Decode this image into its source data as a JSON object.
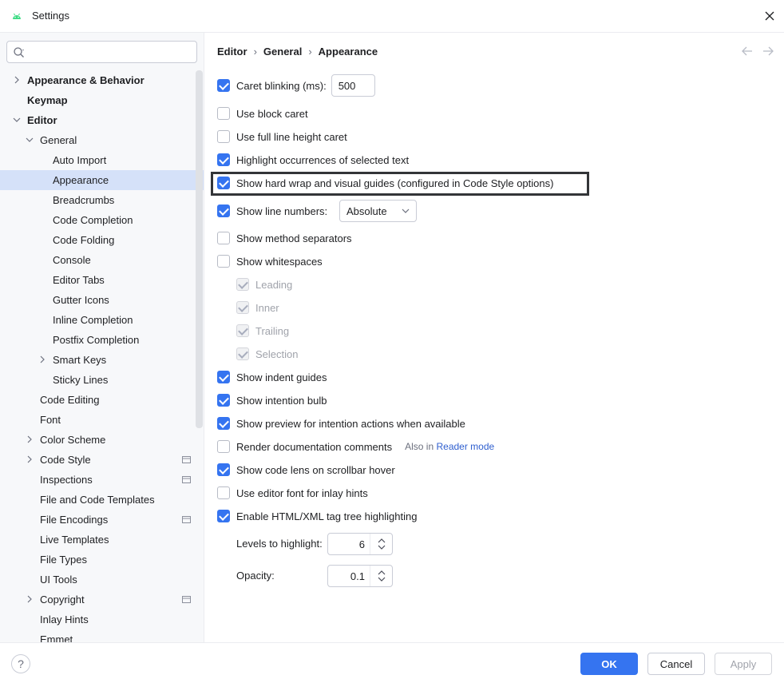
{
  "window": {
    "title": "Settings"
  },
  "search": {
    "value": "",
    "placeholder": ""
  },
  "sidebar": {
    "items": [
      {
        "label": "Appearance & Behavior",
        "bold": true,
        "chevron": "right"
      },
      {
        "label": "Keymap",
        "bold": true,
        "chevron": ""
      },
      {
        "label": "Editor",
        "bold": true,
        "chevron": "down"
      },
      {
        "label": "General",
        "bold": false,
        "chevron": "down"
      },
      {
        "label": "Auto Import",
        "bold": false,
        "chevron": ""
      },
      {
        "label": "Appearance",
        "bold": false,
        "chevron": "",
        "selected": true
      },
      {
        "label": "Breadcrumbs",
        "bold": false,
        "chevron": ""
      },
      {
        "label": "Code Completion",
        "bold": false,
        "chevron": ""
      },
      {
        "label": "Code Folding",
        "bold": false,
        "chevron": ""
      },
      {
        "label": "Console",
        "bold": false,
        "chevron": ""
      },
      {
        "label": "Editor Tabs",
        "bold": false,
        "chevron": ""
      },
      {
        "label": "Gutter Icons",
        "bold": false,
        "chevron": ""
      },
      {
        "label": "Inline Completion",
        "bold": false,
        "chevron": ""
      },
      {
        "label": "Postfix Completion",
        "bold": false,
        "chevron": ""
      },
      {
        "label": "Smart Keys",
        "bold": false,
        "chevron": "right"
      },
      {
        "label": "Sticky Lines",
        "bold": false,
        "chevron": ""
      },
      {
        "label": "Code Editing",
        "bold": false,
        "chevron": ""
      },
      {
        "label": "Font",
        "bold": false,
        "chevron": ""
      },
      {
        "label": "Color Scheme",
        "bold": false,
        "chevron": "right"
      },
      {
        "label": "Code Style",
        "bold": false,
        "chevron": "right",
        "project_icon": true
      },
      {
        "label": "Inspections",
        "bold": false,
        "chevron": "",
        "project_icon": true
      },
      {
        "label": "File and Code Templates",
        "bold": false,
        "chevron": ""
      },
      {
        "label": "File Encodings",
        "bold": false,
        "chevron": "",
        "project_icon": true
      },
      {
        "label": "Live Templates",
        "bold": false,
        "chevron": ""
      },
      {
        "label": "File Types",
        "bold": false,
        "chevron": ""
      },
      {
        "label": "UI Tools",
        "bold": false,
        "chevron": ""
      },
      {
        "label": "Copyright",
        "bold": false,
        "chevron": "right",
        "project_icon": true
      },
      {
        "label": "Inlay Hints",
        "bold": false,
        "chevron": ""
      },
      {
        "label": "Emmet",
        "bold": false,
        "chevron": ""
      }
    ]
  },
  "breadcrumb": [
    "Editor",
    "General",
    "Appearance"
  ],
  "options": {
    "caret_blinking": {
      "label": "Caret blinking (ms):",
      "checked": true,
      "value": "500"
    },
    "block_caret": {
      "label": "Use block caret",
      "checked": false
    },
    "full_line_height_caret": {
      "label": "Use full line height caret",
      "checked": false
    },
    "highlight_occurrences": {
      "label": "Highlight occurrences of selected text",
      "checked": true
    },
    "hard_wrap_guides": {
      "label": "Show hard wrap and visual guides (configured in Code Style options)",
      "checked": true
    },
    "line_numbers": {
      "label": "Show line numbers:",
      "checked": true,
      "selected": "Absolute"
    },
    "method_separators": {
      "label": "Show method separators",
      "checked": false
    },
    "whitespaces": {
      "label": "Show whitespaces",
      "checked": false
    },
    "leading": {
      "label": "Leading",
      "checked": true,
      "disabled": true
    },
    "inner": {
      "label": "Inner",
      "checked": true,
      "disabled": true
    },
    "trailing": {
      "label": "Trailing",
      "checked": true,
      "disabled": true
    },
    "selection": {
      "label": "Selection",
      "checked": true,
      "disabled": true
    },
    "indent_guides": {
      "label": "Show indent guides",
      "checked": true
    },
    "intention_bulb": {
      "label": "Show intention bulb",
      "checked": true
    },
    "intention_preview": {
      "label": "Show preview for intention actions when available",
      "checked": true
    },
    "render_docs": {
      "label": "Render documentation comments",
      "checked": false,
      "also_text": "Also in",
      "also_link": "Reader mode"
    },
    "code_lens": {
      "label": "Show code lens on scrollbar hover",
      "checked": true
    },
    "editor_font_inlay": {
      "label": "Use editor font for inlay hints",
      "checked": false
    },
    "tag_tree": {
      "label": "Enable HTML/XML tag tree highlighting",
      "checked": true
    },
    "levels": {
      "label": "Levels to highlight:",
      "value": "6"
    },
    "opacity": {
      "label": "Opacity:",
      "value": "0.1"
    }
  },
  "footer": {
    "help": "?",
    "ok": "OK",
    "cancel": "Cancel",
    "apply": "Apply"
  },
  "colors": {
    "accent": "#3574f0",
    "selection": "#d5e1f9",
    "sidebar_bg": "#f7f8fa",
    "link": "#2f5fcf"
  }
}
